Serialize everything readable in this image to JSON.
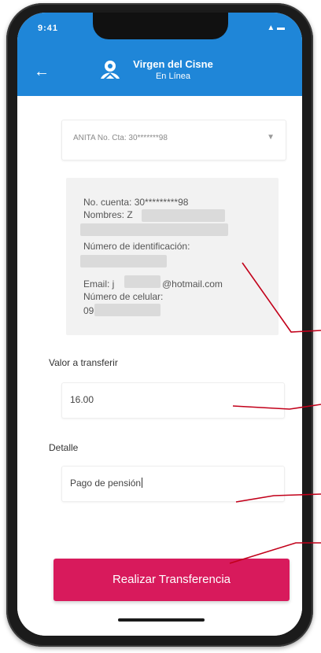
{
  "statusbar": {
    "time": "9:41",
    "icons": "▲ ▬"
  },
  "appbar": {
    "back_icon": "arrow-left-icon",
    "logo_icon": "church-logo-icon",
    "brand_name": "Virgen del Cisne",
    "brand_sub": "En Línea"
  },
  "account_select": {
    "value": "ANITA No. Cta: 30*******98",
    "caret_icon": "chevron-down-icon"
  },
  "info": {
    "account": "No. cuenta: 30*********98",
    "names": "Nombres: Z",
    "id_label": "Número de identificación:",
    "email_prefix": "Email: j",
    "email_suffix": "@hotmail.com",
    "phone_label": "Número de celular:",
    "phone_prefix": "09"
  },
  "amount": {
    "label": "Valor a transferir",
    "value": "16.00"
  },
  "detail": {
    "label": "Detalle",
    "value": "Pago de pensión"
  },
  "submit": {
    "label": "Realizar Transferencia"
  },
  "colors": {
    "appbar": "#1f86d8",
    "button": "#d81a5c",
    "annotation": "#c2001a"
  }
}
